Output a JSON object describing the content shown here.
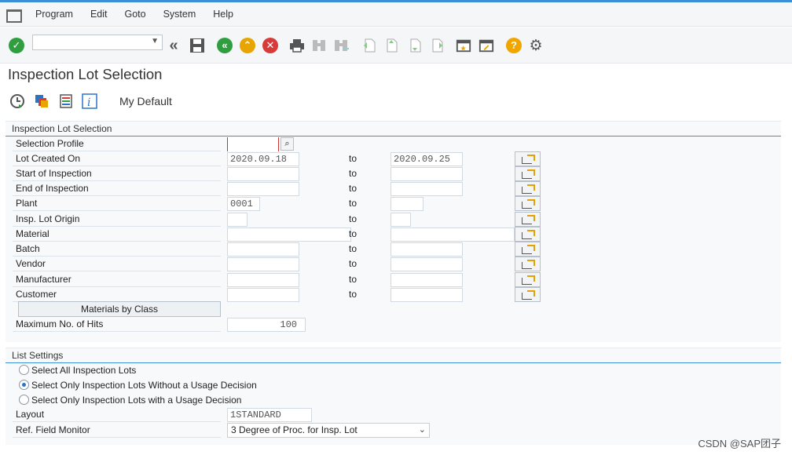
{
  "menu": [
    "Program",
    "Edit",
    "Goto",
    "System",
    "Help"
  ],
  "toolbar": {
    "command_value": ""
  },
  "title": "Inspection Lot Selection",
  "app_toolbar": {
    "variant_label": "My Default"
  },
  "selection": {
    "group_title": "Inspection Lot Selection",
    "to_label": "to",
    "profile_label": "Selection Profile",
    "rows": [
      {
        "label": "Lot Created On",
        "from": "2020.09.18",
        "to": "2020.09.25"
      },
      {
        "label": "Start of Inspection",
        "from": "",
        "to": ""
      },
      {
        "label": "End of Inspection",
        "from": "",
        "to": ""
      },
      {
        "label": "Plant",
        "from": "0001",
        "to": ""
      },
      {
        "label": "Insp. Lot Origin",
        "from": "",
        "to": ""
      },
      {
        "label": "Material",
        "from": "",
        "to": ""
      },
      {
        "label": "Batch",
        "from": "",
        "to": ""
      },
      {
        "label": "Vendor",
        "from": "",
        "to": ""
      },
      {
        "label": "Manufacturer",
        "from": "",
        "to": ""
      },
      {
        "label": "Customer",
        "from": "",
        "to": ""
      }
    ],
    "materials_by_class": "Materials by Class",
    "max_hits_label": "Maximum No. of Hits",
    "max_hits_value": "100"
  },
  "list_settings": {
    "group_title": "List Settings",
    "radios": [
      {
        "label": "Select All Inspection Lots",
        "selected": false
      },
      {
        "label": "Select Only Inspection Lots Without a Usage Decision",
        "selected": true
      },
      {
        "label": "Select Only Inspection Lots with a Usage Decision",
        "selected": false
      }
    ],
    "layout_label": "Layout",
    "layout_value": "1STANDARD",
    "ref_field_label": "Ref. Field Monitor",
    "ref_field_value": "3 Degree of Proc. for Insp. Lot"
  },
  "watermark": "CSDN @SAP团子",
  "colors": {
    "accent": "#3a8fd8",
    "ok": "#2e9e3e",
    "cancel": "#d83a3a",
    "nav": "#e8a400",
    "help": "#f0a500"
  }
}
